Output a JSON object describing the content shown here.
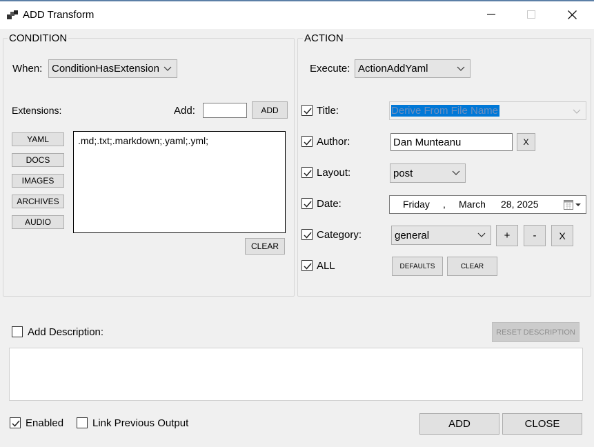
{
  "window": {
    "title": "ADD Transform"
  },
  "condition": {
    "group_title": "CONDITION",
    "when_label": "When:",
    "when_value": "ConditionHasExtension",
    "extensions_label": "Extensions:",
    "add_label": "Add:",
    "add_input_value": "",
    "add_button": "ADD",
    "preset_buttons": [
      "YAML",
      "DOCS",
      "IMAGES",
      "ARCHIVES",
      "AUDIO"
    ],
    "extensions_text": ".md;.txt;.markdown;.yaml;.yml;",
    "clear_button": "CLEAR"
  },
  "action": {
    "group_title": "ACTION",
    "execute_label": "Execute:",
    "execute_value": "ActionAddYaml",
    "title_label": "Title:",
    "title_value": "Derive From File Name",
    "author_label": "Author:",
    "author_value": "Dan Munteanu",
    "author_clear": "X",
    "layout_label": "Layout:",
    "layout_value": "post",
    "date_label": "Date:",
    "date": {
      "weekday": "Friday",
      "sep": ",",
      "month": "March",
      "day": "28, 2025"
    },
    "category_label": "Category:",
    "category_value": "general",
    "category_add": "+",
    "category_remove": "-",
    "category_clear": "X",
    "all_label": "ALL",
    "defaults_button": "DEFAULTS",
    "clear_button": "CLEAR"
  },
  "description": {
    "label": "Add Description:",
    "reset_button": "RESET DESCRIPTION",
    "checked": false
  },
  "footer": {
    "enabled_label": "Enabled",
    "enabled_checked": true,
    "link_label": "Link Previous Output",
    "link_checked": false,
    "add_button": "ADD",
    "close_button": "CLOSE"
  },
  "colors": {
    "selection": "#0078d7",
    "accent": "#5b7fa6",
    "disabled_text": "#8d8d8d"
  }
}
